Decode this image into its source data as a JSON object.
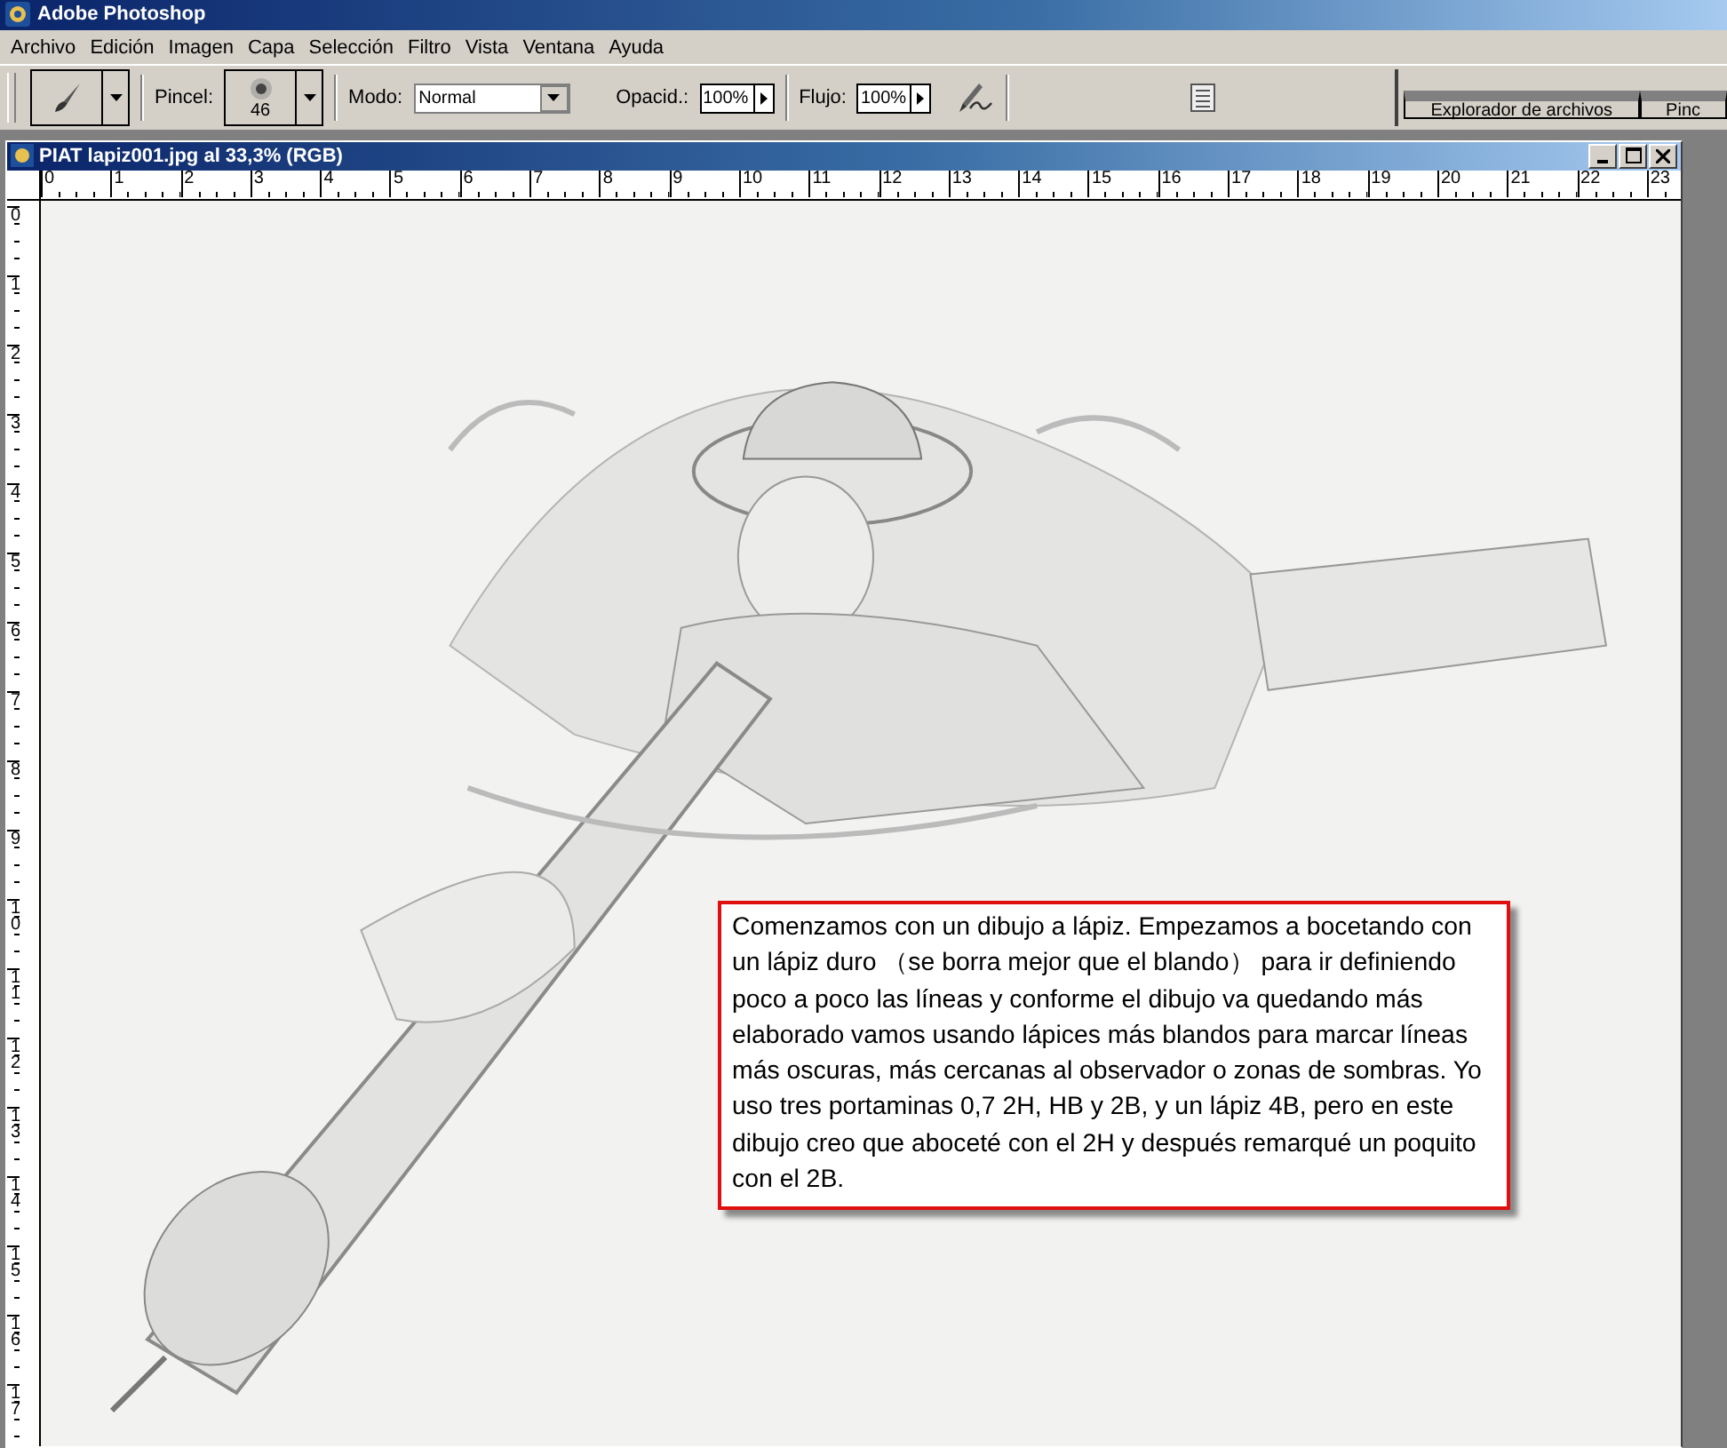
{
  "app_title": "Adobe Photoshop",
  "menu": [
    "Archivo",
    "Edición",
    "Imagen",
    "Capa",
    "Selección",
    "Filtro",
    "Vista",
    "Ventana",
    "Ayuda"
  ],
  "toolbar": {
    "brush_label": "Pincel:",
    "brush_size": "46",
    "mode_label": "Modo:",
    "mode": "Normal",
    "opacity_label": "Opacid.:",
    "opacity": "100%",
    "flow_label": "Flujo:",
    "flow": "100%"
  },
  "palette_tabs": [
    {
      "label": "Explorador de archivos"
    },
    {
      "label": "Pinc"
    }
  ],
  "document": {
    "title": "PIAT lapiz001.jpg al 33,3% (RGB)",
    "top_ruler": [
      "0",
      "1",
      "2",
      "3",
      "4",
      "5",
      "6",
      "7",
      "8",
      "9",
      "10",
      "11",
      "12",
      "13",
      "14",
      "15",
      "16",
      "17",
      "18",
      "19",
      "20",
      "21",
      "22",
      "23"
    ],
    "left_ruler": [
      "0",
      "1",
      "2",
      "3",
      "4",
      "5",
      "6",
      "7",
      "8",
      "9",
      "10",
      "11",
      "12",
      "13",
      "14",
      "15",
      "16",
      "17"
    ],
    "note": "Comenzamos con un dibujo a lápiz. Empezamos a bocetando con un lápiz duro （se borra mejor que el blando） para ir definiendo poco a poco las líneas y conforme el dibujo va quedando más elaborado vamos usando lápices más blandos para marcar líneas más oscuras, más cercanas al observador o zonas de sombras. Yo uso tres portaminas 0,7 2H, HB y 2B, y un lápiz 4B, pero en este dibujo creo que aboceté con el 2H y después remarqué un poquito con el 2B."
  }
}
